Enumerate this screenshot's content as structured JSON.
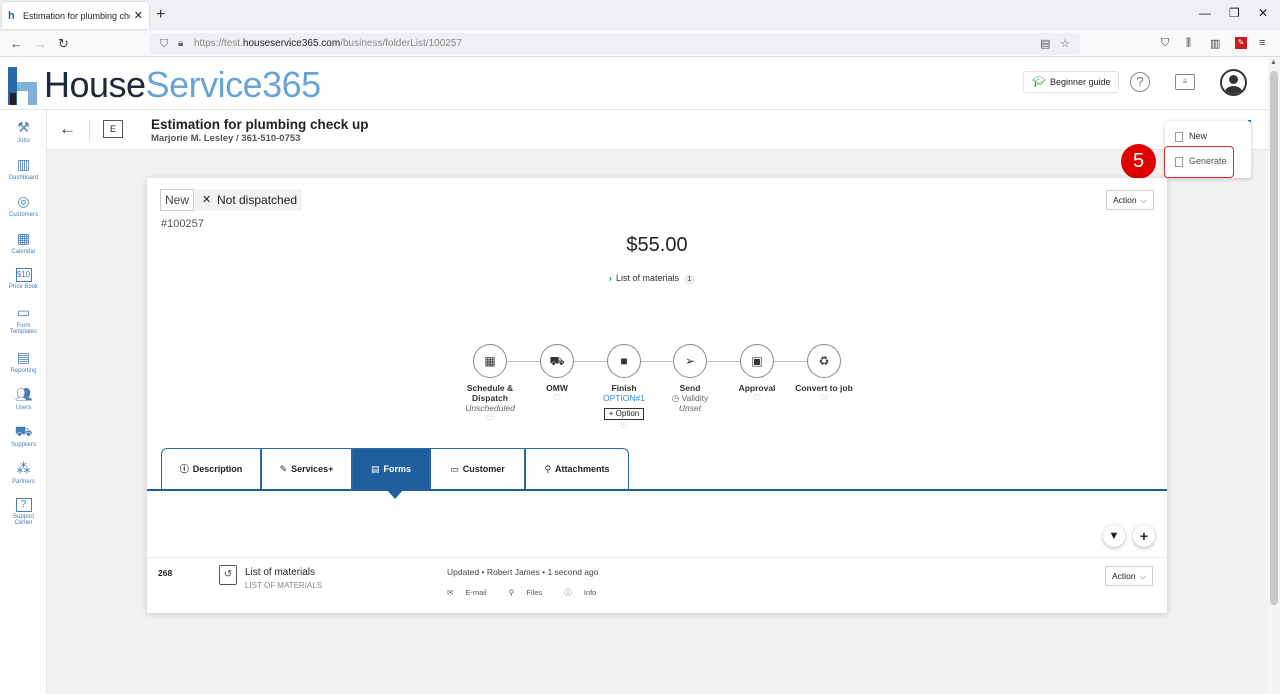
{
  "browser": {
    "tab_title": "Estimation for plumbing check",
    "url_prefix": "https://test.",
    "url_domain": "houseservice365.com",
    "url_path": "/business/folderList/100257"
  },
  "header": {
    "logo_part1": "House",
    "logo_part2": "Service365",
    "beginner_guide": "Beginner guide"
  },
  "sidebar": {
    "items": [
      {
        "label": "Jobs",
        "icon": "tools-icon"
      },
      {
        "label": "Dashboard",
        "icon": "chart-icon"
      },
      {
        "label": "Customers",
        "icon": "target-icon"
      },
      {
        "label": "Calendar",
        "icon": "calendar-icon"
      },
      {
        "label": "Price Book",
        "icon": "price-tag-icon"
      },
      {
        "label": "Form",
        "label2": "Templates",
        "icon": "form-icon"
      },
      {
        "label": "Reporting",
        "icon": "report-icon"
      },
      {
        "label": "Users",
        "icon": "users-icon"
      },
      {
        "label": "Suppliers",
        "icon": "truck-icon"
      },
      {
        "label": "Partners",
        "icon": "network-icon"
      },
      {
        "label": "Support",
        "label2": "Center",
        "icon": "support-icon"
      }
    ]
  },
  "page": {
    "type_badge": "E",
    "title": "Estimation for plumbing check up",
    "subtitle": "Marjorie M. Lesley / 361-510-0753"
  },
  "dropdown": {
    "items": [
      "New",
      "Generate"
    ],
    "step_number": "5"
  },
  "card": {
    "status_new": "New",
    "status_dispatch": "Not dispatched",
    "doc_number": "#100257",
    "action_label": "Action",
    "price": "$55.00",
    "materials_link": "List of materials",
    "materials_count": "1"
  },
  "workflow": {
    "steps": [
      {
        "label": "Schedule &",
        "label2": "Dispatch",
        "sub": "Unscheduled"
      },
      {
        "label": "OMW"
      },
      {
        "label": "Finish",
        "option": "OPTION#1",
        "add_option": "+ Option"
      },
      {
        "label": "Send",
        "validity": "Validity",
        "sub": "Unset"
      },
      {
        "label": "Approval"
      },
      {
        "label": "Convert to job"
      }
    ]
  },
  "tabs": [
    {
      "label": "Description",
      "icon": "info-icon"
    },
    {
      "label": "Services+",
      "icon": "wrench-icon"
    },
    {
      "label": "Forms",
      "icon": "document-icon"
    },
    {
      "label": "Customer",
      "icon": "id-card-icon"
    },
    {
      "label": "Attachments",
      "icon": "paperclip-icon"
    }
  ],
  "forms_list": {
    "rows": [
      {
        "id": "268",
        "title": "List of materials",
        "subtitle": "LIST OF MATERIALS",
        "updated": "Updated • Robert James • 1 second ago",
        "links": [
          "E-mail",
          "Files",
          "Info"
        ],
        "action": "Action"
      }
    ]
  },
  "colors": {
    "brand_dark": "#1f5f9f",
    "brand_light": "#6aa4d6",
    "highlight": "#e00000"
  }
}
